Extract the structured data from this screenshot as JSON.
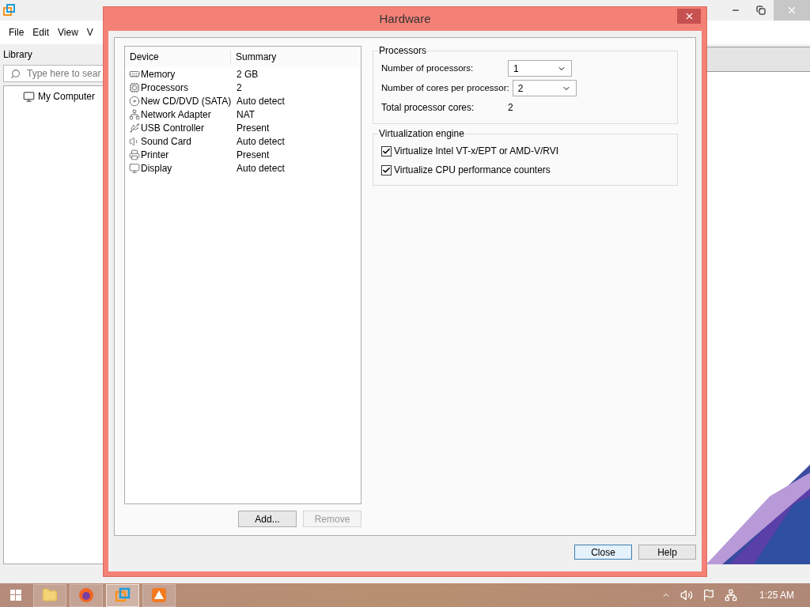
{
  "app": {
    "menu": [
      {
        "label": "File"
      },
      {
        "label": "Edit"
      },
      {
        "label": "View"
      },
      {
        "label": "V"
      }
    ],
    "library": {
      "title": "Library",
      "search": {
        "placeholder": "Type here to sear"
      },
      "tree": [
        {
          "label": "My Computer"
        }
      ]
    }
  },
  "dialog": {
    "title": "Hardware",
    "columns": [
      "Device",
      "Summary"
    ],
    "devices": [
      {
        "name": "Memory",
        "summary": "2 GB",
        "selected": false
      },
      {
        "name": "Processors",
        "summary": "2",
        "selected": false
      },
      {
        "name": "New CD/DVD (SATA)",
        "summary": "Auto detect",
        "selected": false
      },
      {
        "name": "Network Adapter",
        "summary": "NAT",
        "selected": false
      },
      {
        "name": "USB Controller",
        "summary": "Present",
        "selected": false
      },
      {
        "name": "Sound Card",
        "summary": "Auto detect",
        "selected": false
      },
      {
        "name": "Printer",
        "summary": "Present",
        "selected": false
      },
      {
        "name": "Display",
        "summary": "Auto detect",
        "selected": false
      }
    ],
    "list_buttons": [
      {
        "label": "Add...",
        "disabled": false
      },
      {
        "label": "Remove",
        "disabled": true
      }
    ],
    "processors": {
      "title": "Processors",
      "fields": [
        {
          "label": "Number of processors:",
          "value": "1"
        },
        {
          "label": "Number of cores per processor:",
          "value": "2"
        }
      ],
      "total": {
        "label": "Total processor cores:",
        "value": "2"
      }
    },
    "virtualization": {
      "title": "Virtualization engine",
      "options": [
        {
          "label": "Virtualize Intel VT-x/EPT or AMD-V/RVI",
          "checked": true
        },
        {
          "label": "Virtualize CPU performance counters",
          "checked": true
        }
      ]
    },
    "footer_buttons": [
      {
        "label": "Close",
        "default": true
      },
      {
        "label": "Help",
        "default": false
      }
    ]
  },
  "taskbar": {
    "apps": [
      {
        "selected": false
      },
      {
        "selected": false
      },
      {
        "selected": true
      },
      {
        "selected": false
      }
    ],
    "clock": "1:25 AM"
  }
}
